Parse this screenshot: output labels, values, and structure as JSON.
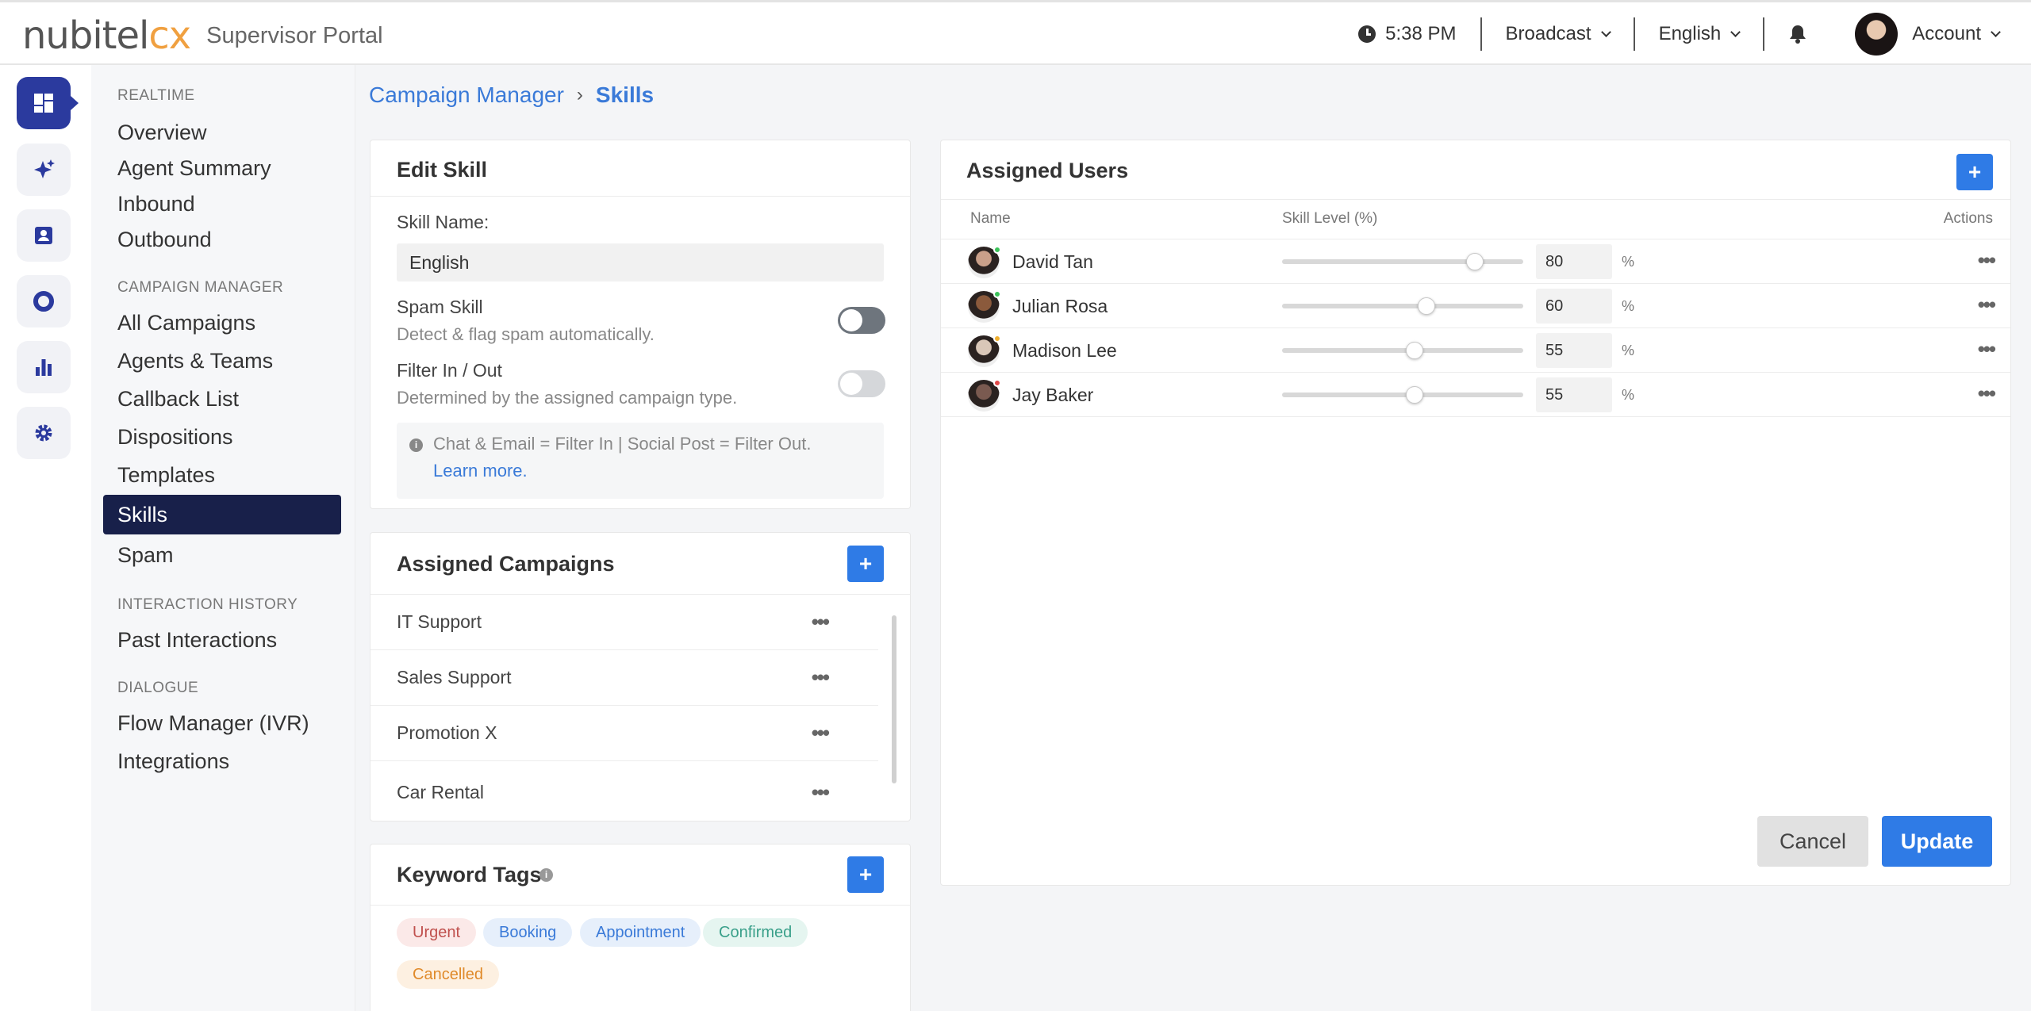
{
  "app": {
    "logo": "nubitel",
    "logo_accent": "cx",
    "portal": "Supervisor Portal"
  },
  "topbar": {
    "time": "5:38 PM",
    "broadcast": "Broadcast",
    "language": "English",
    "account": "Account"
  },
  "sidebar": {
    "sections": [
      {
        "title": "REALTIME",
        "items": [
          "Overview",
          "Agent Summary",
          "Inbound",
          "Outbound"
        ]
      },
      {
        "title": "CAMPAIGN MANAGER",
        "items": [
          "All Campaigns",
          "Agents & Teams",
          "Callback List",
          "Dispositions",
          "Templates",
          "Skills",
          "Spam"
        ]
      },
      {
        "title": "INTERACTION HISTORY",
        "items": [
          "Past Interactions"
        ]
      },
      {
        "title": "DIALOGUE",
        "items": [
          "Flow Manager (IVR)",
          "Integrations"
        ]
      }
    ],
    "active": "Skills"
  },
  "breadcrumb": {
    "parent": "Campaign Manager",
    "sep": "›",
    "current": "Skills"
  },
  "edit_skill": {
    "title": "Edit Skill",
    "name_label": "Skill Name:",
    "name_value": "English",
    "spam_label": "Spam Skill",
    "spam_desc": "Detect & flag spam automatically.",
    "spam_on": false,
    "filter_label": "Filter In / Out",
    "filter_desc": "Determined by the assigned campaign type.",
    "filter_on": false,
    "info_text": "Chat & Email = Filter In | Social Post = Filter Out.",
    "info_link": "Learn more."
  },
  "assigned_campaigns": {
    "title": "Assigned Campaigns",
    "add": "+",
    "items": [
      "IT Support",
      "Sales Support",
      "Promotion X",
      "Car Rental"
    ]
  },
  "keyword_tags": {
    "title": "Keyword Tags",
    "add": "+",
    "tags": [
      {
        "label": "Urgent",
        "color": "#c0504d",
        "bg": "#fbe9e8"
      },
      {
        "label": "Booking",
        "color": "#3a7ad8",
        "bg": "#e6effb"
      },
      {
        "label": "Appointment",
        "color": "#3a7ad8",
        "bg": "#e6effb"
      },
      {
        "label": "Confirmed",
        "color": "#3aa08a",
        "bg": "#e5f5f0"
      },
      {
        "label": "Cancelled",
        "color": "#e08a2a",
        "bg": "#fdf0e1"
      }
    ]
  },
  "assigned_users": {
    "title": "Assigned Users",
    "add": "+",
    "columns": {
      "name": "Name",
      "level": "Skill Level (%)",
      "actions": "Actions"
    },
    "percent_sign": "%",
    "users": [
      {
        "name": "David Tan",
        "level": 80,
        "status": "#3cc25a"
      },
      {
        "name": "Julian Rosa",
        "level": 60,
        "status": "#3cc25a"
      },
      {
        "name": "Madison Lee",
        "level": 55,
        "status": "#f0b030"
      },
      {
        "name": "Jay Baker",
        "level": 55,
        "status": "#e04a4a"
      }
    ]
  },
  "actions": {
    "cancel": "Cancel",
    "update": "Update"
  },
  "colors": {
    "primary": "#2f7be6",
    "nav_active": "#18204a",
    "rail_active": "#2b3a9e"
  }
}
